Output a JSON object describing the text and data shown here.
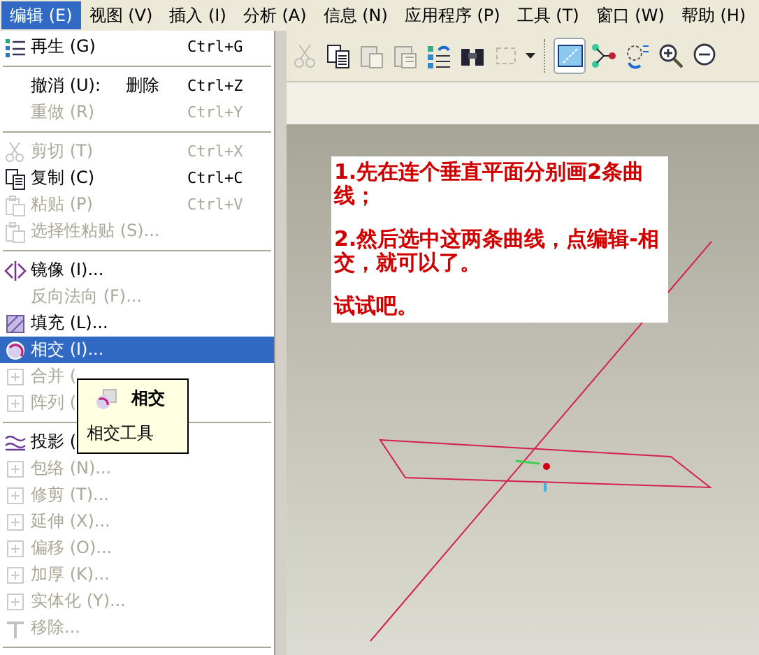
{
  "menubar": [
    {
      "label": "编辑 (E)",
      "selected": true
    },
    {
      "label": "视图 (V)",
      "selected": false
    },
    {
      "label": "插入 (I)",
      "selected": false
    },
    {
      "label": "分析 (A)",
      "selected": false
    },
    {
      "label": "信息 (N)",
      "selected": false
    },
    {
      "label": "应用程序 (P)",
      "selected": false
    },
    {
      "label": "工具 (T)",
      "selected": false
    },
    {
      "label": "窗口 (W)",
      "selected": false
    },
    {
      "label": "帮助 (H)",
      "selected": false
    }
  ],
  "menu": [
    {
      "kind": "item",
      "label": "再生 (G)",
      "shortcut": "Ctrl+G",
      "disabled": false,
      "selected": false
    },
    {
      "kind": "separator"
    },
    {
      "kind": "item",
      "label": "撤消 (U):",
      "extra": "删除",
      "shortcut": "Ctrl+Z",
      "disabled": false,
      "selected": false
    },
    {
      "kind": "item",
      "label": "重做 (R)",
      "shortcut": "Ctrl+Y",
      "disabled": true,
      "selected": false
    },
    {
      "kind": "separator"
    },
    {
      "kind": "item",
      "label": "剪切 (T)",
      "shortcut": "Ctrl+X",
      "disabled": true,
      "selected": false
    },
    {
      "kind": "item",
      "label": "复制 (C)",
      "shortcut": "Ctrl+C",
      "disabled": false,
      "selected": false
    },
    {
      "kind": "item",
      "label": "粘贴 (P)",
      "shortcut": "Ctrl+V",
      "disabled": true,
      "selected": false
    },
    {
      "kind": "item",
      "label": "选择性粘贴 (S)...",
      "disabled": true,
      "selected": false
    },
    {
      "kind": "separator"
    },
    {
      "kind": "item",
      "label": "镜像 (I)...",
      "disabled": false,
      "selected": false
    },
    {
      "kind": "item",
      "label": "反向法向 (F)...",
      "disabled": true,
      "selected": false
    },
    {
      "kind": "item",
      "label": "填充 (L)...",
      "disabled": false,
      "selected": false
    },
    {
      "kind": "item",
      "label": "相交 (I)...",
      "disabled": false,
      "selected": true
    },
    {
      "kind": "item",
      "label": "合并 (",
      "disabled": true,
      "selected": false
    },
    {
      "kind": "item",
      "label": "阵列 (",
      "disabled": true,
      "selected": false
    },
    {
      "kind": "separator"
    },
    {
      "kind": "item",
      "label": "投影 (",
      "disabled": false,
      "selected": false
    },
    {
      "kind": "item",
      "label": "包络 (N)...",
      "disabled": true,
      "selected": false
    },
    {
      "kind": "item",
      "label": "修剪 (T)...",
      "disabled": true,
      "selected": false
    },
    {
      "kind": "item",
      "label": "延伸 (X)...",
      "disabled": true,
      "selected": false
    },
    {
      "kind": "item",
      "label": "偏移 (O)...",
      "disabled": true,
      "selected": false
    },
    {
      "kind": "item",
      "label": "加厚 (K)...",
      "disabled": true,
      "selected": false
    },
    {
      "kind": "item",
      "label": "实体化 (Y)...",
      "disabled": true,
      "selected": false
    },
    {
      "kind": "item",
      "label": "移除...",
      "disabled": true,
      "selected": false
    },
    {
      "kind": "separator"
    }
  ],
  "tooltip": {
    "title": "相交",
    "description": "相交工具"
  },
  "toolbar": [
    {
      "disabled": true,
      "pressed": false
    },
    {
      "disabled": false,
      "pressed": false
    },
    {
      "disabled": true,
      "pressed": false
    },
    {
      "disabled": true,
      "pressed": false
    },
    {
      "disabled": false,
      "pressed": false
    },
    {
      "disabled": false,
      "pressed": false
    },
    {
      "disabled": true,
      "pressed": false
    },
    {
      "disabled": false,
      "pressed": false
    },
    {
      "disabled": false,
      "pressed": true
    },
    {
      "disabled": false,
      "pressed": false
    },
    {
      "disabled": false,
      "pressed": false
    },
    {
      "disabled": false,
      "pressed": false
    },
    {
      "disabled": false,
      "pressed": false
    }
  ],
  "note": [
    "1.先在连个垂直平面分别画2条曲线；",
    "2.然后选中这两条曲线，点编辑-相交，就可以了。",
    "试试吧。"
  ]
}
